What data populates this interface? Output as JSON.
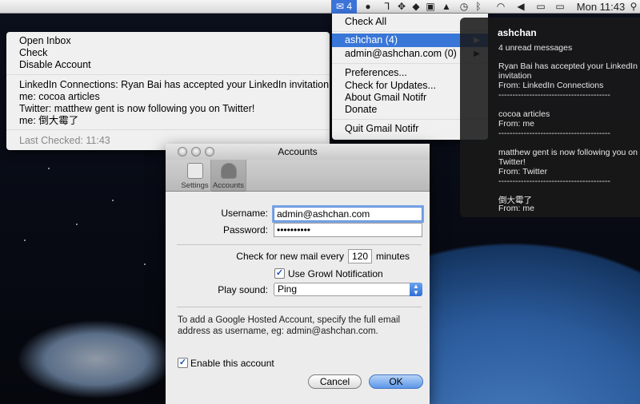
{
  "menubar": {
    "mail_icon": "envelope-icon",
    "mail_count": "4",
    "clock": "Mon 11:43"
  },
  "dropdown": {
    "actions": [
      "Open Inbox",
      "Check",
      "Disable Account"
    ],
    "messages": [
      "LinkedIn Connections: Ryan Bai has accepted your LinkedIn invitation",
      "me: cocoa articles",
      "Twitter: matthew gent is now following you on Twitter!",
      "me: 倒大霉了"
    ],
    "last_checked": "Last Checked: 11:43"
  },
  "menu": {
    "check_all": "Check All",
    "accounts": [
      "ashchan (4)",
      "admin@ashchan.com (0)"
    ],
    "items": [
      "Preferences...",
      "Check for Updates...",
      "About Gmail Notifr",
      "Donate"
    ],
    "quit": "Quit Gmail Notifr",
    "selected_color": "#3876d8"
  },
  "growl": {
    "title": "ashchan",
    "lines": [
      "4 unread messages",
      "Ryan Bai has accepted your LinkedIn",
      "invitation",
      "From: LinkedIn Connections",
      "----------------------------------------",
      "cocoa articles",
      "From: me",
      "----------------------------------------",
      "matthew gent is now following you on",
      "Twitter!",
      "From: Twitter",
      "----------------------------------------",
      "倒大霉了",
      "From: me"
    ]
  },
  "window": {
    "title": "Accounts",
    "toolbar": [
      "Settings",
      "Accounts"
    ],
    "username_label": "Username:",
    "username_value": "admin@ashchan.com",
    "password_label": "Password:",
    "password_value": "••••••••••",
    "interval_prefix": "Check for new mail every",
    "interval_value": "120",
    "interval_suffix": "minutes",
    "growl_label": "Use Growl Notification",
    "sound_label": "Play sound:",
    "sound_value": "Ping",
    "note": "To add a Google Hosted Account, specify the full email address as username, eg: admin@ashchan.com.",
    "enable_label": "Enable this account",
    "cancel": "Cancel",
    "ok": "OK"
  }
}
